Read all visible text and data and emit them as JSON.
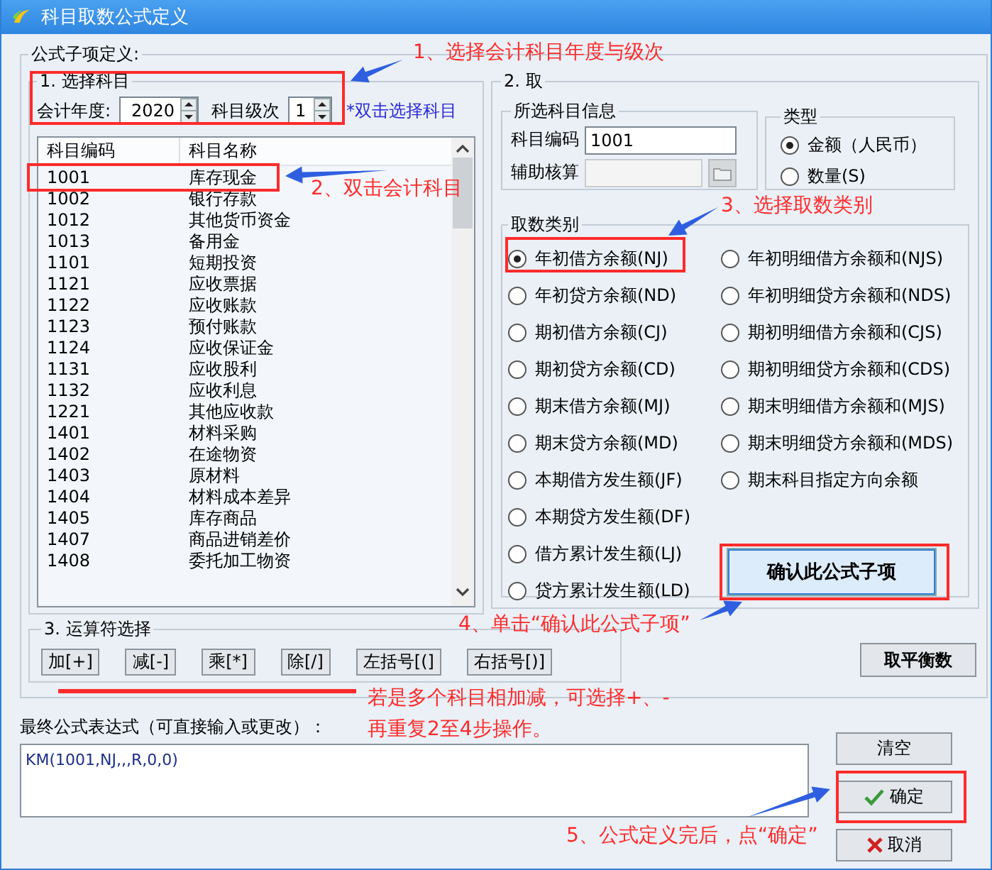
{
  "window": {
    "title": "科目取数公式定义"
  },
  "formula_group": {
    "label": "公式子项定义:"
  },
  "section1": {
    "label": "1. 选择科目",
    "year_label": "会计年度:",
    "year": "2020",
    "level_label": "科目级次",
    "level": "1",
    "hint": "*双击选择科目",
    "columns": [
      "科目编码",
      "科目名称"
    ],
    "rows": [
      {
        "code": "1001",
        "name": "库存现金"
      },
      {
        "code": "1002",
        "name": "银行存款"
      },
      {
        "code": "1012",
        "name": "其他货币资金"
      },
      {
        "code": "1013",
        "name": "备用金"
      },
      {
        "code": "1101",
        "name": "短期投资"
      },
      {
        "code": "1121",
        "name": "应收票据"
      },
      {
        "code": "1122",
        "name": "应收账款"
      },
      {
        "code": "1123",
        "name": "预付账款"
      },
      {
        "code": "1124",
        "name": "应收保证金"
      },
      {
        "code": "1131",
        "name": "应收股利"
      },
      {
        "code": "1132",
        "name": "应收利息"
      },
      {
        "code": "1221",
        "name": "其他应收款"
      },
      {
        "code": "1401",
        "name": "材料采购"
      },
      {
        "code": "1402",
        "name": "在途物资"
      },
      {
        "code": "1403",
        "name": "原材料"
      },
      {
        "code": "1404",
        "name": "材料成本差异"
      },
      {
        "code": "1405",
        "name": "库存商品"
      },
      {
        "code": "1407",
        "name": "商品进销差价"
      },
      {
        "code": "1408",
        "name": "委托加工物资"
      }
    ]
  },
  "section2": {
    "label": "2. 取",
    "info_group": {
      "label": "所选科目信息",
      "code_label": "科目编码",
      "code": "1001",
      "aux_label": "辅助核算"
    },
    "type_group": {
      "label": "类型",
      "options": [
        {
          "label": "金额（人民币）",
          "selected": true
        },
        {
          "label": "数量(S)",
          "selected": false
        }
      ]
    },
    "category_group": {
      "label": "取数类别",
      "left": [
        {
          "label": "年初借方余额(NJ)",
          "selected": true
        },
        {
          "label": "年初贷方余额(ND)",
          "selected": false
        },
        {
          "label": "期初借方余额(CJ)",
          "selected": false
        },
        {
          "label": "期初贷方余额(CD)",
          "selected": false
        },
        {
          "label": "期末借方余额(MJ)",
          "selected": false
        },
        {
          "label": "期末贷方余额(MD)",
          "selected": false
        },
        {
          "label": "本期借方发生额(JF)",
          "selected": false
        },
        {
          "label": "本期贷方发生额(DF)",
          "selected": false
        },
        {
          "label": "借方累计发生额(LJ)",
          "selected": false
        },
        {
          "label": "贷方累计发生额(LD)",
          "selected": false
        }
      ],
      "right": [
        {
          "label": "年初明细借方余额和(NJS)",
          "selected": false
        },
        {
          "label": "年初明细贷方余额和(NDS)",
          "selected": false
        },
        {
          "label": "期初明细借方余额和(CJS)",
          "selected": false
        },
        {
          "label": "期初明细贷方余额和(CDS)",
          "selected": false
        },
        {
          "label": "期末明细借方余额和(MJS)",
          "selected": false
        },
        {
          "label": "期末明细贷方余额和(MDS)",
          "selected": false
        },
        {
          "label": "期末科目指定方向余额",
          "selected": false
        }
      ]
    },
    "confirm_button": "确认此公式子项"
  },
  "section3": {
    "label": "3. 运算符选择",
    "operators": [
      "加[+]",
      "减[-]",
      "乘[*]",
      "除[/]",
      "左括号[(]",
      "右括号[)]"
    ]
  },
  "balance_button": "取平衡数",
  "expression": {
    "label": "最终公式表达式（可直接输入或更改）：",
    "value": "KM(1001,NJ,,,R,0,0)"
  },
  "buttons": [
    {
      "kind": "clear",
      "label": "清空"
    },
    {
      "kind": "ok",
      "label": "确定"
    },
    {
      "kind": "cancel",
      "label": "取消"
    }
  ],
  "annotations": [
    {
      "text": "1、选择会计科目年度与级次"
    },
    {
      "text": "2、双击会计科目"
    },
    {
      "text": "3、选择取数类别"
    },
    {
      "text": "4、单击“确认此公式子项”"
    },
    {
      "text": "若是多个科目相加减，可选择+、-"
    },
    {
      "text": "再重复2至4步操作。"
    },
    {
      "text": "5、公式定义完后，点“确定”"
    }
  ]
}
